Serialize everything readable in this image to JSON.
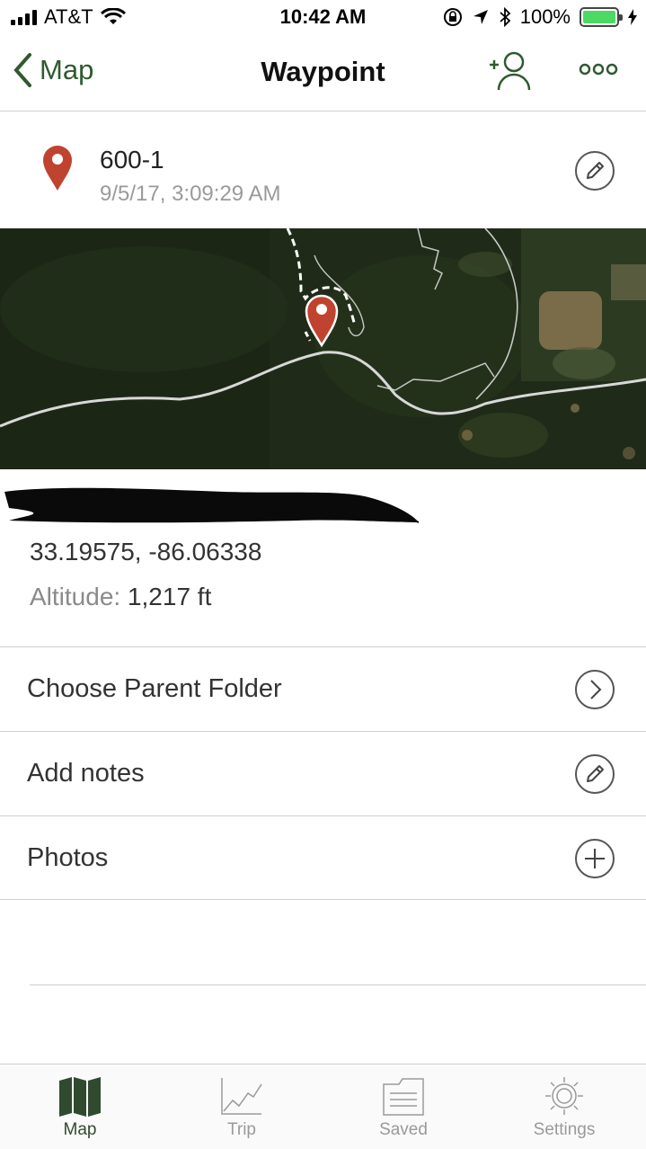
{
  "status_bar": {
    "carrier": "AT&T",
    "time": "10:42 AM",
    "battery": "100%"
  },
  "nav": {
    "back_label": "Map",
    "title": "Waypoint"
  },
  "waypoint": {
    "name": "600-1",
    "datetime": "9/5/17, 3:09:29 AM",
    "coordinates": "33.19575, -86.06338",
    "altitude_label": "Altitude:",
    "altitude_value": "1,217 ft"
  },
  "rows": {
    "parent_folder": "Choose Parent Folder",
    "notes": "Add notes",
    "photos": "Photos"
  },
  "tabbar": {
    "map": "Map",
    "trip": "Trip",
    "saved": "Saved",
    "settings": "Settings"
  },
  "colors": {
    "accent_green": "#2f5a2f",
    "pin_red": "#c0432f",
    "battery_green": "#4cd964"
  },
  "icons": [
    "signal-icon",
    "wifi-icon",
    "orientation-lock-icon",
    "location-arrow-icon",
    "bluetooth-icon",
    "battery-icon",
    "chevron-left-icon",
    "add-user-icon",
    "more-icon",
    "pin-icon",
    "pencil-icon",
    "chevron-right-icon",
    "plus-icon",
    "map-icon",
    "chart-icon",
    "folder-icon",
    "sun-icon"
  ]
}
